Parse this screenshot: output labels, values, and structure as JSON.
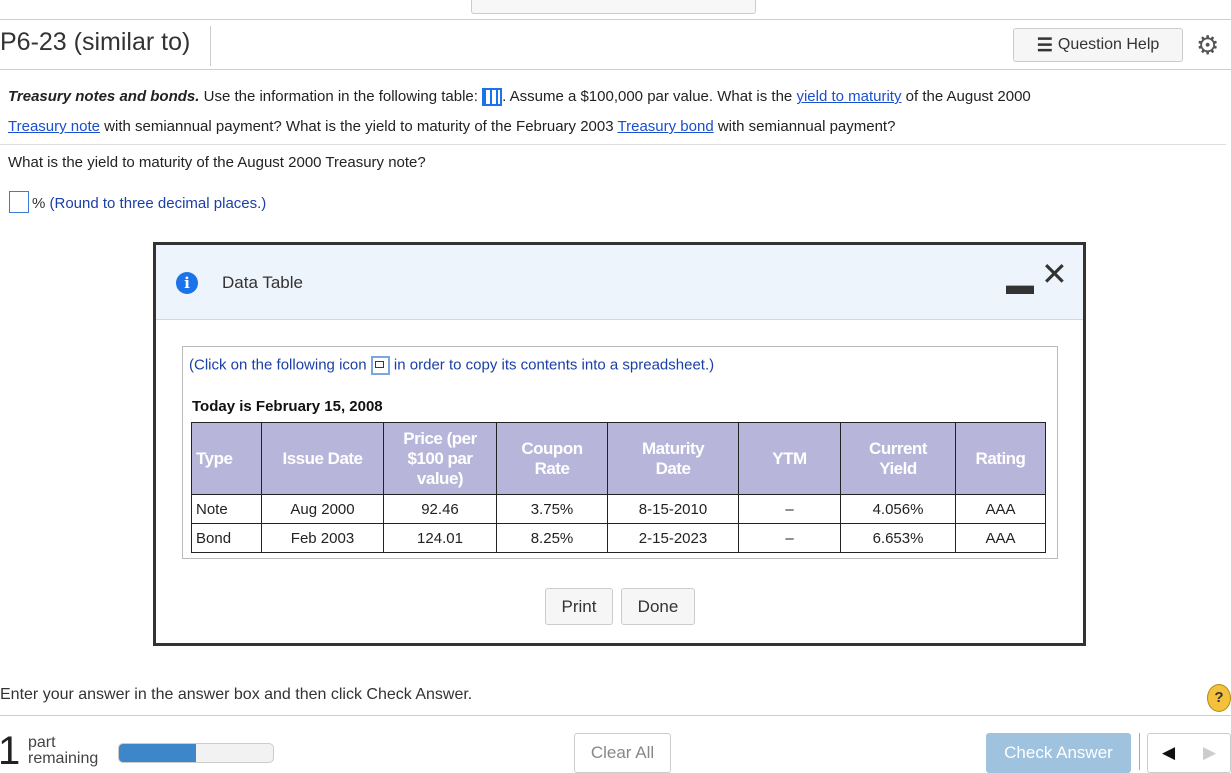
{
  "header": {
    "title": "P6-23 (similar to)",
    "question_help": "Question Help",
    "icons": [
      "list-icon",
      "gear-icon"
    ]
  },
  "question": {
    "bold_lead": "Treasury notes and bonds.",
    "text1": " Use the information in the following table: ",
    "text2": ". Assume a $100,000 par value. What is the ",
    "link_ytm": "yield to maturity",
    "text3": " of the August 2000",
    "link_note": "Treasury note",
    "text4": " with semiannual payment? What is the yield to maturity of the February 2003 ",
    "link_bond": "Treasury bond",
    "text5": " with semiannual payment?",
    "sub": "What is the yield to maturity of the August 2000 Treasury note?",
    "answer_value": "",
    "unit": "%",
    "hint": "(Round to three decimal places.)"
  },
  "dialog": {
    "title": "Data Table",
    "instr1": "(Click on the following icon",
    "instr2": " in order to copy its contents into a spreadsheet.)",
    "date": "Today is February 15, 2008",
    "columns": [
      "Type",
      "Issue Date",
      "Price (per $100 par value)",
      "Coupon Rate",
      "Maturity Date",
      "YTM",
      "Current Yield",
      "Rating"
    ],
    "rows": [
      [
        "Note",
        "Aug 2000",
        "92.46",
        "3.75%",
        "8-15-2010",
        "–",
        "4.056%",
        "AAA"
      ],
      [
        "Bond",
        "Feb 2003",
        "124.01",
        "8.25%",
        "2-15-2023",
        "–",
        "6.653%",
        "AAA"
      ]
    ],
    "print": "Print",
    "done": "Done"
  },
  "footer": {
    "instruction": "Enter your answer in the answer box and then click Check Answer.",
    "parts_count": "1",
    "parts_label1": "part",
    "parts_label2": "remaining",
    "progress_percent": 50,
    "clear_all": "Clear All",
    "check_answer": "Check Answer",
    "help_icon": "?"
  },
  "colors": {
    "header_bg": "#b8b5da",
    "accent": "#3d86c9",
    "check_answer_bg": "#9fc2de"
  }
}
